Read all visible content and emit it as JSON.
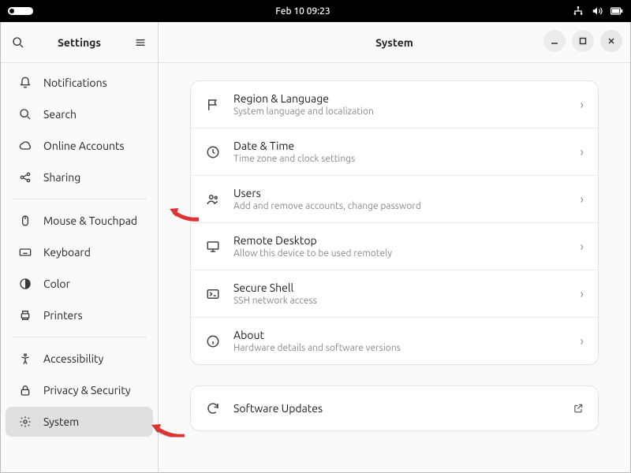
{
  "topbar": {
    "datetime": "Feb 10  09:23"
  },
  "sidebar": {
    "title": "Settings",
    "items": [
      {
        "label": "Notifications"
      },
      {
        "label": "Search"
      },
      {
        "label": "Online Accounts"
      },
      {
        "label": "Sharing"
      },
      {
        "label": "Mouse & Touchpad"
      },
      {
        "label": "Keyboard"
      },
      {
        "label": "Color"
      },
      {
        "label": "Printers"
      },
      {
        "label": "Accessibility"
      },
      {
        "label": "Privacy & Security"
      },
      {
        "label": "System"
      }
    ]
  },
  "main": {
    "title": "System",
    "rows": [
      {
        "title": "Region & Language",
        "sub": "System language and localization"
      },
      {
        "title": "Date & Time",
        "sub": "Time zone and clock settings"
      },
      {
        "title": "Users",
        "sub": "Add and remove accounts, change password"
      },
      {
        "title": "Remote Desktop",
        "sub": "Allow this device to be used remotely"
      },
      {
        "title": "Secure Shell",
        "sub": "SSH network access"
      },
      {
        "title": "About",
        "sub": "Hardware details and software versions"
      }
    ],
    "updates": {
      "title": "Software Updates"
    }
  }
}
